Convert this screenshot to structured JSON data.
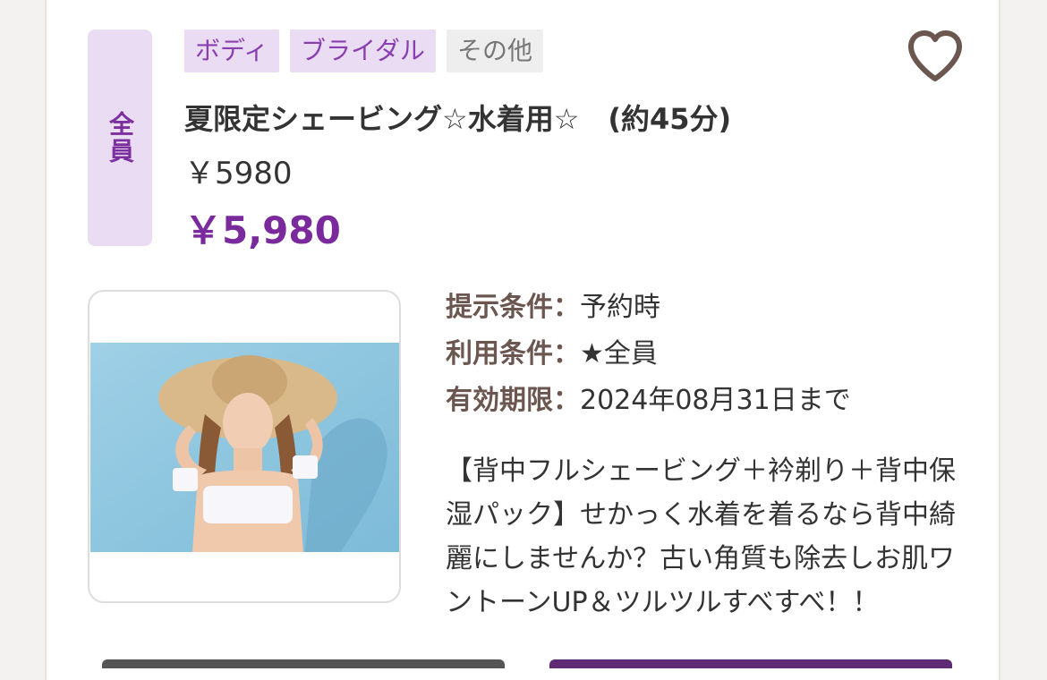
{
  "coupon": {
    "audience": "全員",
    "tags": [
      "ボディ",
      "ブライダル",
      "その他"
    ],
    "title": "夏限定シェービング☆水着用☆　(約45分)",
    "price_plain": "￥5980",
    "price_sale": "￥5,980",
    "favorite_icon": "heart-outline-icon",
    "photo_icon": "photo-woman-straw-hat",
    "conditions": [
      {
        "label": "提示条件：",
        "value": "予約時"
      },
      {
        "label": "利用条件：",
        "value": "★全員"
      },
      {
        "label": "有効期限：",
        "value": "2024年08月31日まで"
      }
    ],
    "description": "【背中フルシェービング＋衿剃り＋背中保湿パック】せかっく水着を着るなら背中綺麗にしませんか？古い角質も除去しお肌ワントーンUP＆ツルツルすべすべ！！"
  },
  "colors": {
    "accent": "#7a2a9c",
    "tag_bg": "#eadcf3",
    "label": "#6b5650",
    "heart": "#6b5650"
  }
}
